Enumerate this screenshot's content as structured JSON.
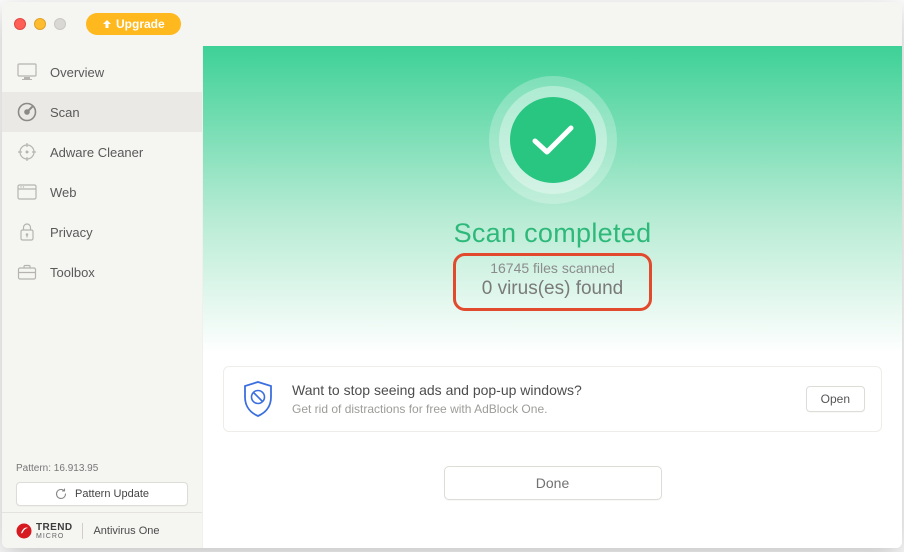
{
  "titlebar": {
    "upgrade_label": "Upgrade"
  },
  "sidebar": {
    "items": [
      {
        "label": "Overview"
      },
      {
        "label": "Scan"
      },
      {
        "label": "Adware Cleaner"
      },
      {
        "label": "Web"
      },
      {
        "label": "Privacy"
      },
      {
        "label": "Toolbox"
      }
    ],
    "pattern_label": "Pattern: 16.913.95",
    "pattern_update_label": "Pattern Update",
    "brand_name": "TREND",
    "brand_sub": "MICRO",
    "product_name": "Antivirus One"
  },
  "main": {
    "scan_title": "Scan completed",
    "files_scanned": "16745 files scanned",
    "viruses_found": "0 virus(es) found",
    "promo": {
      "title": "Want to stop seeing ads and pop-up windows?",
      "subtitle": "Get rid of distractions for free with AdBlock One.",
      "open_label": "Open"
    },
    "done_label": "Done"
  },
  "colors": {
    "accent_green": "#28c681",
    "upgrade_orange": "#ffb81e",
    "highlight_red": "#e24a2d"
  }
}
